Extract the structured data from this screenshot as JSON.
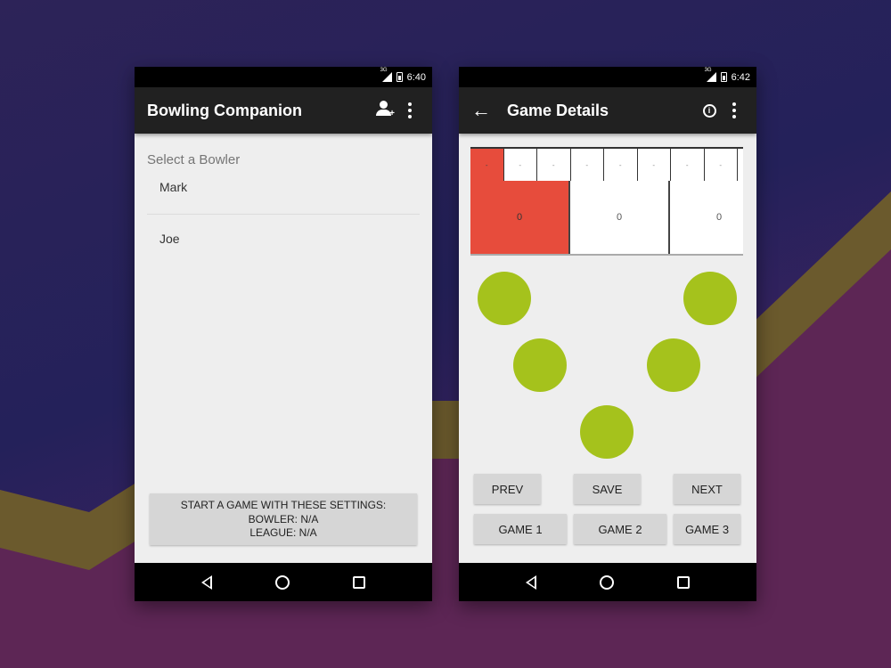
{
  "background": {
    "top_color": "#26225a",
    "band_color": "#6e5a2c",
    "bottom_color": "#5a2852"
  },
  "left_screen": {
    "status": {
      "time": "6:40",
      "network": "3G"
    },
    "appbar": {
      "title": "Bowling Companion",
      "add_icon": "add-person-icon",
      "menu_icon": "overflow-menu-icon"
    },
    "select_label": "Select a Bowler",
    "bowlers": [
      {
        "name": "Mark"
      },
      {
        "name": "Joe"
      }
    ],
    "start_button": {
      "line1": "START A GAME WITH THESE SETTINGS:",
      "line2": "BOWLER: N/A",
      "line3": "LEAGUE: N/A"
    }
  },
  "right_screen": {
    "status": {
      "time": "6:42",
      "network": "3G"
    },
    "appbar": {
      "title": "Game Details",
      "info_icon": "info-icon",
      "menu_icon": "overflow-menu-icon"
    },
    "scoresheet": {
      "balls": [
        "-",
        "-",
        "-",
        "-",
        "-",
        "-",
        "-",
        "-",
        "-"
      ],
      "frames": [
        "0",
        "0",
        "0"
      ],
      "active_color": "#e74c3c"
    },
    "pin_color": "#a5c21c",
    "pins_standing": 5,
    "buttons": {
      "prev": "PREV",
      "save": "SAVE",
      "next": "NEXT",
      "game1": "GAME 1",
      "game2": "GAME 2",
      "game3": "GAME 3"
    }
  }
}
